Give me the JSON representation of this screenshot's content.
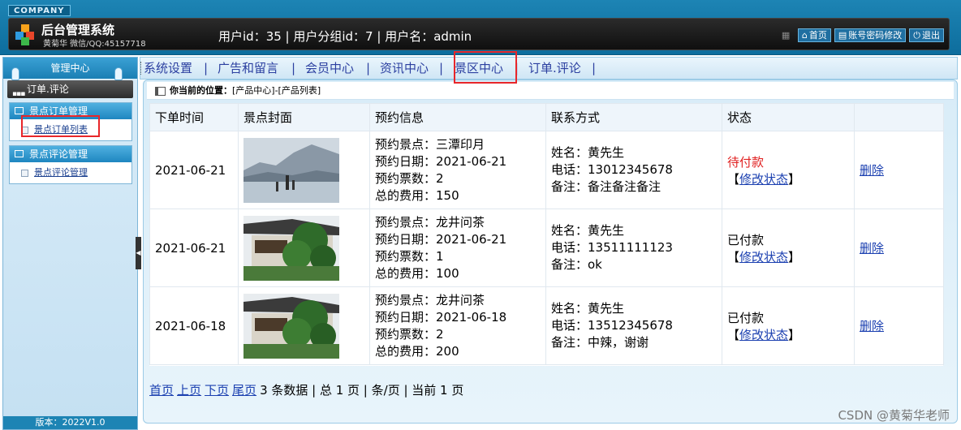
{
  "header": {
    "company": "COMPANY",
    "title": "后台管理系统",
    "subtitle": "黄菊华 微信/QQ:45157718",
    "user_info": "用户id：35 | 用户分组id：7 | 用户名：admin",
    "links": {
      "home": "首页",
      "password": "账号密码修改",
      "logout": "退出"
    }
  },
  "sidebar": {
    "title": "管理中心",
    "current": "订单.评论",
    "groups": [
      {
        "title": "景点订单管理",
        "items": [
          "景点订单列表"
        ]
      },
      {
        "title": "景点评论管理",
        "items": [
          "景点评论管理"
        ]
      }
    ],
    "version": "版本：2022V1.0"
  },
  "topnav": {
    "items": [
      "系统设置",
      "广告和留言",
      "会员中心",
      "资讯中心",
      "景区中心",
      "订单.评论"
    ],
    "separator": "|"
  },
  "breadcrumb": {
    "label": "你当前的位置：",
    "path": "[产品中心]-[产品列表]"
  },
  "table": {
    "headers": [
      "下单时间",
      "景点封面",
      "预约信息",
      "联系方式",
      "状态",
      ""
    ],
    "rows": [
      {
        "date": "2021-06-21",
        "cover": "lake-pagoda-image",
        "info": [
          "预约景点：三潭印月",
          "预约日期：2021-06-21",
          "预约票数：2",
          "总的费用：150"
        ],
        "contact": [
          "姓名：黄先生",
          "电话：13012345678",
          "备注：备注备注备注"
        ],
        "status": "待付款",
        "edit": "修改状态",
        "delete": "删除"
      },
      {
        "date": "2021-06-21",
        "cover": "tea-house-image",
        "info": [
          "预约景点：龙井问茶",
          "预约日期：2021-06-21",
          "预约票数：1",
          "总的费用：100"
        ],
        "contact": [
          "姓名：黄先生",
          "电话：13511111123",
          "备注：ok"
        ],
        "status": "已付款",
        "edit": "修改状态",
        "delete": "删除"
      },
      {
        "date": "2021-06-18",
        "cover": "tea-house-image",
        "info": [
          "预约景点：龙井问茶",
          "预约日期：2021-06-18",
          "预约票数：2",
          "总的费用：200"
        ],
        "contact": [
          "姓名：黄先生",
          "电话：13512345678",
          "备注：中辣，谢谢"
        ],
        "status": "已付款",
        "edit": "修改状态",
        "delete": "删除"
      }
    ]
  },
  "pager": {
    "first": "首页",
    "prev": "上页",
    "next": "下页",
    "last": "尾页",
    "summary": "3 条数据 | 总 1 页 | 条/页 | 当前 1 页"
  },
  "watermark": "CSDN @黄菊华老师",
  "colors": {
    "header": "#1d84b4",
    "highlight": "#e8262a",
    "unpaid": "#e02020",
    "link": "#1a3fb0"
  }
}
